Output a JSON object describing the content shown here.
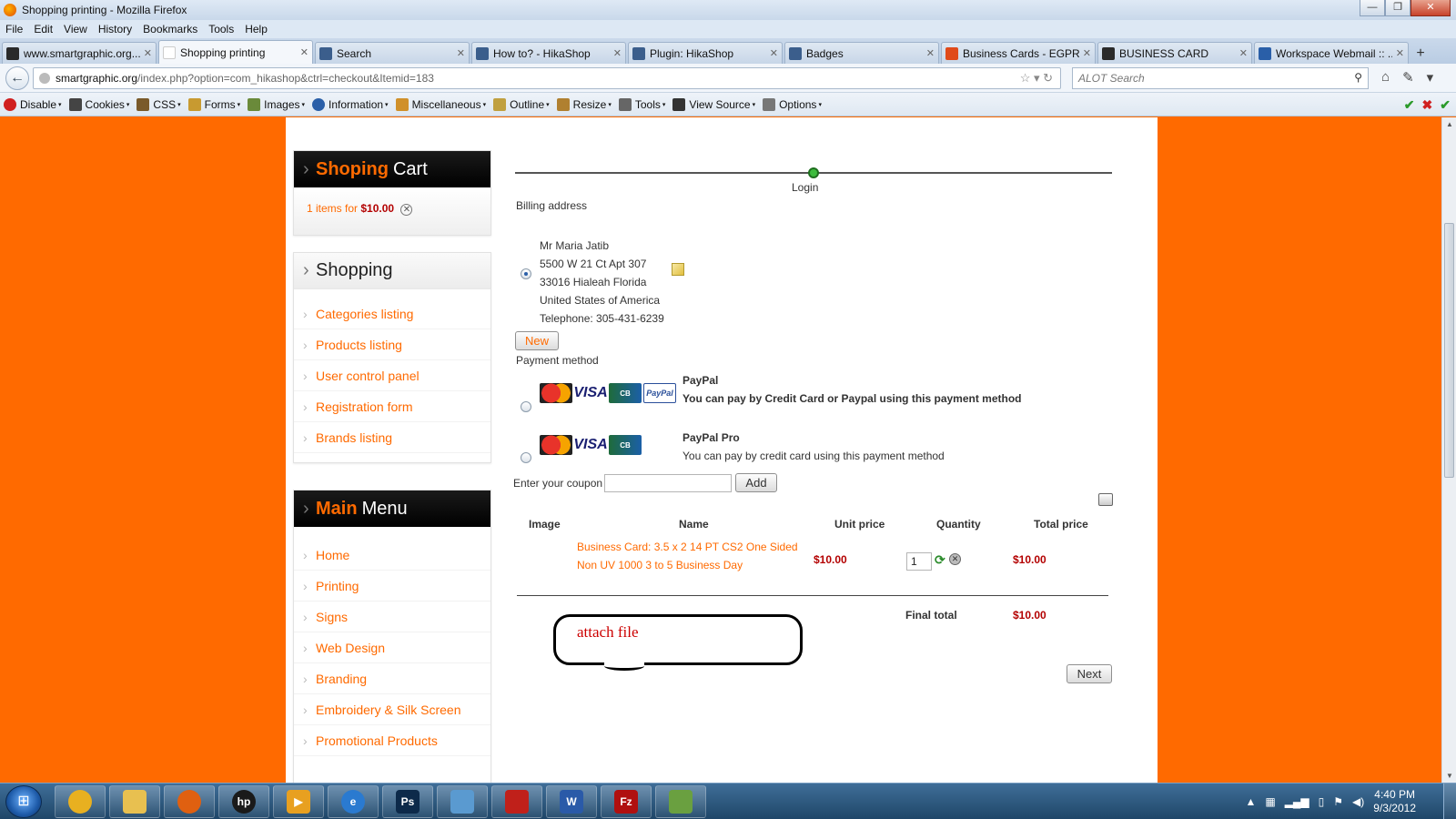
{
  "window": {
    "title": "Shopping printing - Mozilla Firefox"
  },
  "menubar": [
    "File",
    "Edit",
    "View",
    "History",
    "Bookmarks",
    "Tools",
    "Help"
  ],
  "tabs": [
    {
      "label": "www.smartgraphic.org...",
      "icon_color": "#2a2a2a"
    },
    {
      "label": "Shopping printing",
      "icon_color": "#ffffff"
    },
    {
      "label": "Search",
      "icon_color": "#3b5e8c"
    },
    {
      "label": "How to? - HikaShop",
      "icon_color": "#3b5e8c"
    },
    {
      "label": "Plugin: HikaShop",
      "icon_color": "#3b5e8c"
    },
    {
      "label": "Badges",
      "icon_color": "#3b5e8c"
    },
    {
      "label": "Business Cards - EGPRI...",
      "icon_color": "#e04a1a"
    },
    {
      "label": "BUSINESS CARD",
      "icon_color": "#2a2a2a"
    },
    {
      "label": "Workspace Webmail :: ...",
      "icon_color": "#2a5fa8"
    }
  ],
  "url": {
    "host": "smartgraphic.org",
    "path": "/index.php?option=com_hikashop&ctrl=checkout&Itemid=183"
  },
  "search": {
    "placeholder": "ALOT Search"
  },
  "devbar": [
    {
      "label": "Disable",
      "color": "#d02020"
    },
    {
      "label": "Cookies",
      "color": "#444444"
    },
    {
      "label": "CSS",
      "color": "#7a5a2a"
    },
    {
      "label": "Forms",
      "color": "#c89a30"
    },
    {
      "label": "Images",
      "color": "#6a8a3a"
    },
    {
      "label": "Information",
      "color": "#2a5fa8"
    },
    {
      "label": "Miscellaneous",
      "color": "#d0902a"
    },
    {
      "label": "Outline",
      "color": "#c0a040"
    },
    {
      "label": "Resize",
      "color": "#b08030"
    },
    {
      "label": "Tools",
      "color": "#666666"
    },
    {
      "label": "View Source",
      "color": "#333333"
    },
    {
      "label": "Options",
      "color": "#777777"
    }
  ],
  "sidebar": {
    "cart": {
      "title_highlight": "Shoping",
      "title_rest": "Cart",
      "summary": "1 items for",
      "amount": "$10.00"
    },
    "shopping": {
      "title": "Shopping",
      "items": [
        "Categories listing",
        "Products listing",
        "User control panel",
        "Registration form",
        "Brands listing"
      ]
    },
    "main_menu": {
      "title_highlight": "Main",
      "title_rest": "Menu",
      "items": [
        "Home",
        "Printing",
        "Signs",
        "Web Design",
        "Branding",
        "Embroidery & Silk Screen",
        "Promotional Products"
      ]
    }
  },
  "checkout": {
    "step_label": "Login",
    "billing_label": "Billing address",
    "address": [
      "Mr Maria Jatib",
      "5500 W 21 Ct Apt 307",
      "33016 Hialeah Florida",
      "United States of America",
      "Telephone: 305-431-6239"
    ],
    "new_button": "New",
    "payment_label": "Payment method",
    "payments": [
      {
        "title": "PayPal",
        "desc": "You can pay by Credit Card or Paypal using this payment method"
      },
      {
        "title": "PayPal Pro",
        "desc": "You can pay by credit card using this payment method"
      }
    ],
    "card_labels": {
      "visa": "VISA",
      "paypal": "PayPal"
    },
    "coupon_label": "Enter your coupon",
    "add_button": "Add",
    "table": {
      "headers": [
        "Image",
        "Name",
        "Unit price",
        "Quantity",
        "Total price"
      ],
      "row": {
        "name_line1": "Business Card: 3.5 x 2 14 PT CS2 One Sided",
        "name_line2": "Non UV 1000 3 to 5 Business Day",
        "unit_price": "$10.00",
        "quantity": "1",
        "total": "$10.00"
      },
      "final_label": "Final total",
      "final_value": "$10.00"
    },
    "annotation": "attach file",
    "next_button": "Next"
  },
  "taskbar": {
    "apps": [
      {
        "name": "chrome",
        "color": "#e8b020",
        "glyph": ""
      },
      {
        "name": "explorer-folder",
        "color": "#e8c050",
        "glyph": ""
      },
      {
        "name": "firefox",
        "color": "#e06010",
        "glyph": ""
      },
      {
        "name": "hp",
        "color": "#1a1a1a",
        "glyph": "hp"
      },
      {
        "name": "media",
        "color": "#e8a020",
        "glyph": "▶"
      },
      {
        "name": "ie",
        "color": "#2a7ad0",
        "glyph": "e"
      },
      {
        "name": "photoshop",
        "color": "#0d2a4a",
        "glyph": "Ps"
      },
      {
        "name": "app-blue",
        "color": "#5a9ad0",
        "glyph": ""
      },
      {
        "name": "acrobat",
        "color": "#c0201a",
        "glyph": ""
      },
      {
        "name": "word",
        "color": "#2a5aa8",
        "glyph": "W"
      },
      {
        "name": "filezilla",
        "color": "#b01010",
        "glyph": "Fz"
      },
      {
        "name": "notepad",
        "color": "#6aa040",
        "glyph": ""
      }
    ],
    "time": "4:40 PM",
    "date": "9/3/2012"
  }
}
